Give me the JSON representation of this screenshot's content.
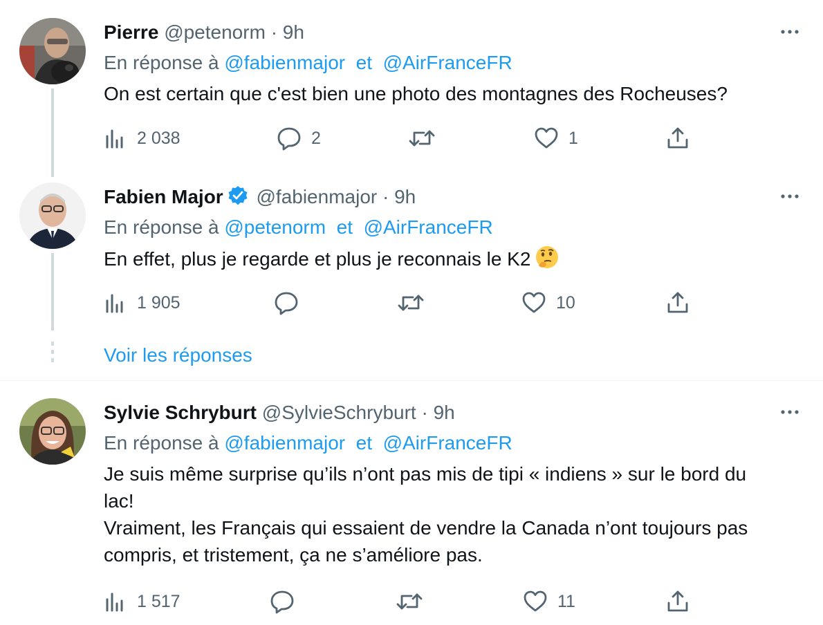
{
  "tweets": [
    {
      "name": "Pierre",
      "handle": "@petenorm",
      "sep": "·",
      "time": "9h",
      "reply_prefix": "En réponse à",
      "reply_to_1": "@fabienmajor",
      "reply_and": "et",
      "reply_to_2": "@AirFranceFR",
      "text_lines": [
        "On est certain que c'est bien une photo des montagnes des Rocheuses?"
      ],
      "views": "2 038",
      "replies": "2",
      "retweets": "",
      "likes": "1"
    },
    {
      "name": "Fabien Major",
      "verified": true,
      "handle": "@fabienmajor",
      "sep": "·",
      "time": "9h",
      "reply_prefix": "En réponse à",
      "reply_to_1": "@petenorm",
      "reply_and": "et",
      "reply_to_2": "@AirFranceFR",
      "text_lines": [
        "En effet, plus je regarde et plus je reconnais le K2"
      ],
      "emoji": "thinking-face",
      "views": "1 905",
      "replies": "",
      "retweets": "",
      "likes": "10"
    },
    {
      "name": "Sylvie Schryburt",
      "handle": "@SylvieSchryburt",
      "sep": "·",
      "time": "9h",
      "reply_prefix": "En réponse à",
      "reply_to_1": "@fabienmajor",
      "reply_and": "et",
      "reply_to_2": "@AirFranceFR",
      "text_lines": [
        "Je suis même surprise qu’ils n’ont pas mis de tipi « indiens » sur le bord du",
        "lac!",
        "Vraiment, les Français qui essaient de vendre la Canada n’ont toujours pas",
        "compris, et tristement, ça ne s’améliore pas."
      ],
      "views": "1 517",
      "replies": "",
      "retweets": "",
      "likes": "11"
    }
  ],
  "show_replies_label": "Voir les réponses",
  "colors": {
    "link": "#1d9bf0",
    "muted": "#536471",
    "text": "#0f1419",
    "thread_line": "#cfd9de",
    "verified": "#1d9bf0"
  },
  "icons": [
    "views-icon",
    "reply-icon",
    "retweet-icon",
    "like-icon",
    "share-icon",
    "more-icon",
    "verified-badge-icon"
  ]
}
